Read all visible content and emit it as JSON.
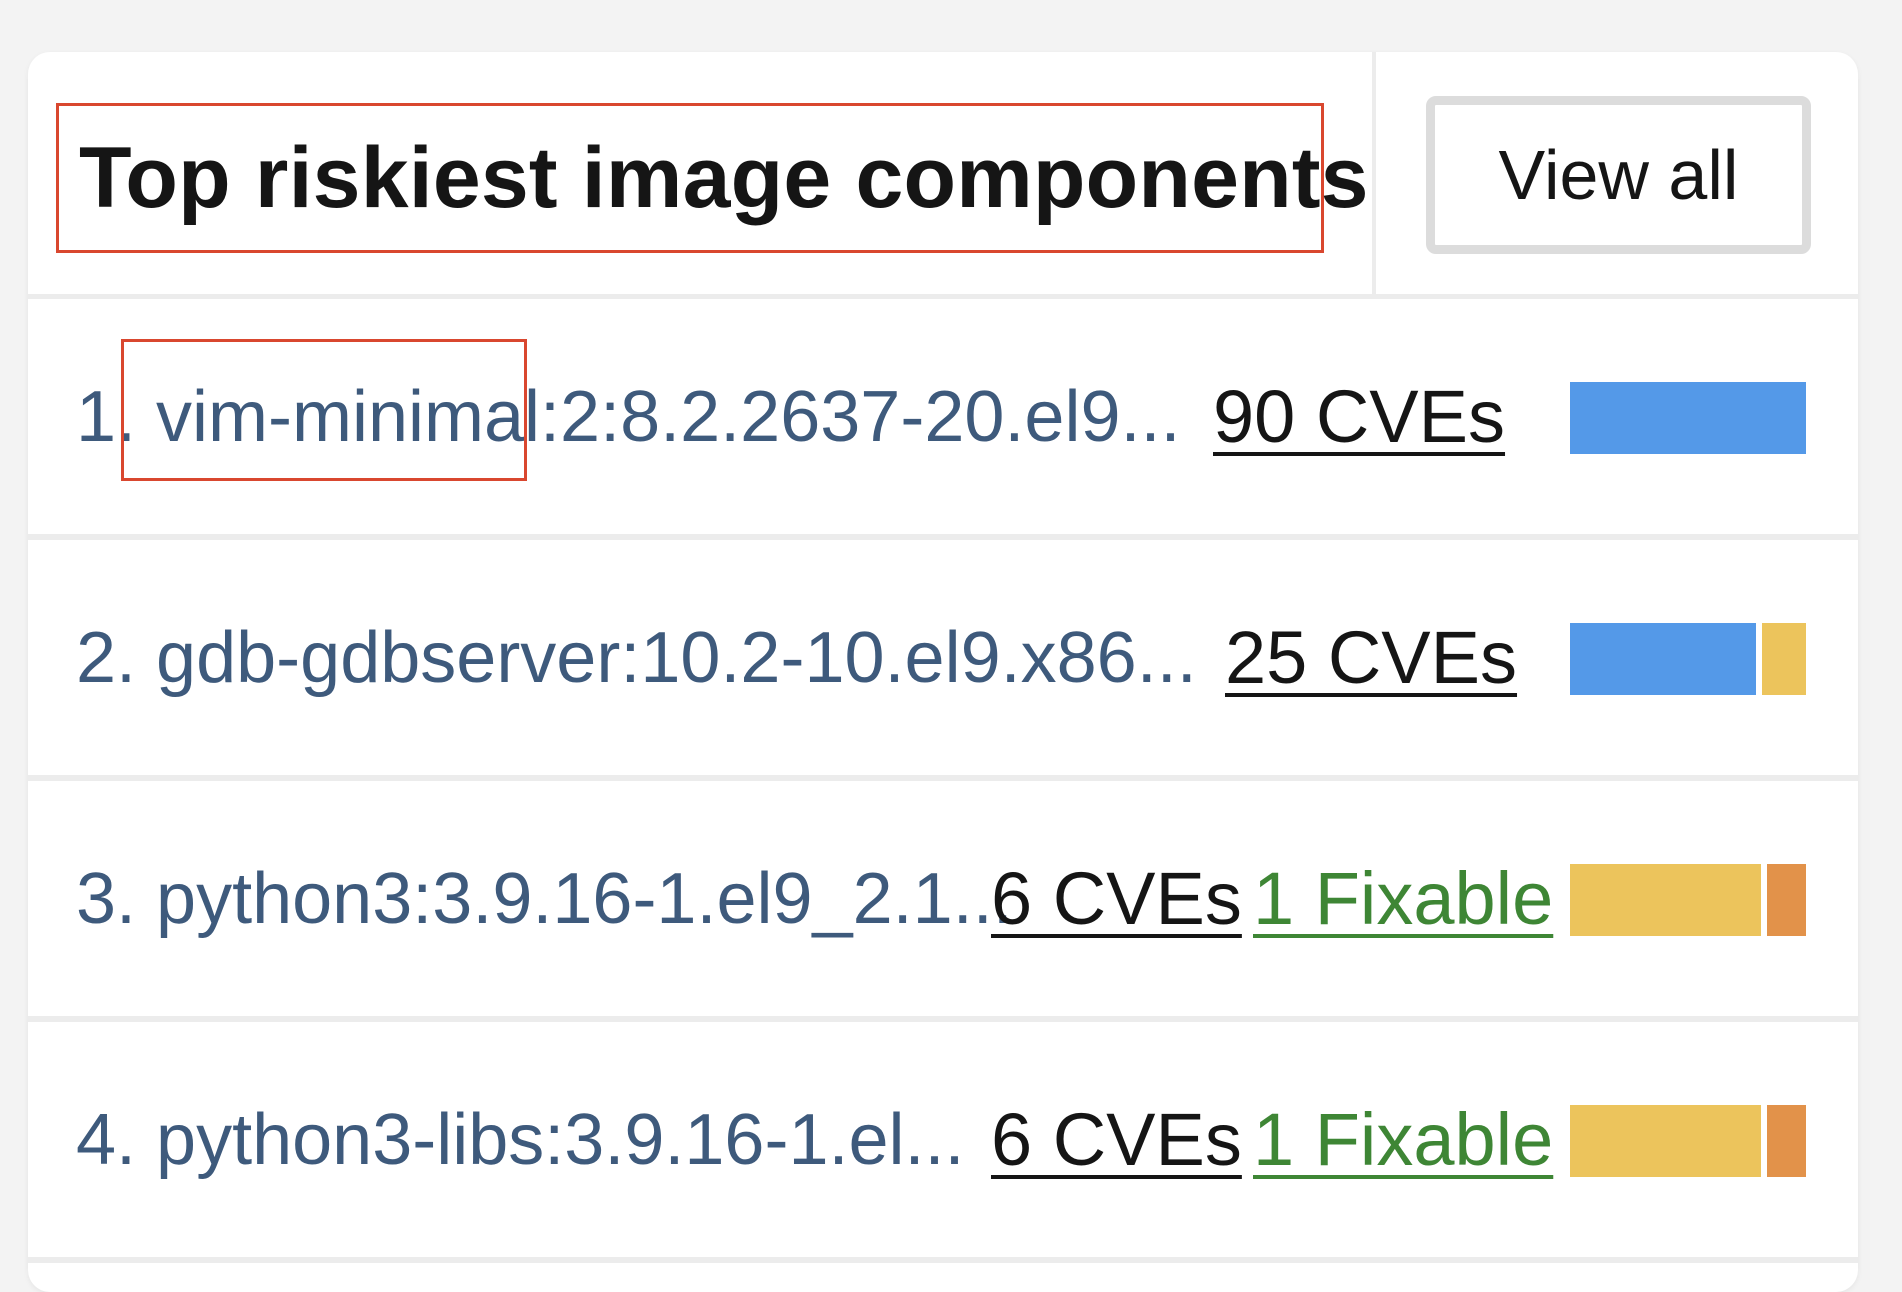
{
  "widget": {
    "title": "Top riskiest image components",
    "view_all_label": "View all"
  },
  "colors": {
    "important": "#5499e8",
    "moderate": "#ecc45c",
    "critical": "#e2924a",
    "fixable": "#3e8635",
    "highlight": "#d9472f"
  },
  "rows": [
    {
      "name": "1. vim-minimal:2:8.2.2637-20.el9...",
      "cves": "90 CVEs",
      "fixable": "",
      "severity_share": {
        "important": 1.0,
        "moderate": 0.0,
        "critical": 0.0
      }
    },
    {
      "name": "2. gdb-gdbserver:10.2-10.el9.x86...",
      "cves": "25 CVEs",
      "fixable": "",
      "severity_share": {
        "important": 0.81,
        "moderate": 0.19,
        "critical": 0.0
      }
    },
    {
      "name": "3. python3:3.9.16-1.el9_2.1...",
      "cves": "6 CVEs",
      "fixable": "1 Fixable",
      "severity_share": {
        "important": 0.0,
        "moderate": 0.83,
        "critical": 0.17
      }
    },
    {
      "name": "4. python3-libs:3.9.16-1.el...",
      "cves": "6 CVEs",
      "fixable": "1 Fixable",
      "severity_share": {
        "important": 0.0,
        "moderate": 0.83,
        "critical": 0.17
      }
    }
  ]
}
